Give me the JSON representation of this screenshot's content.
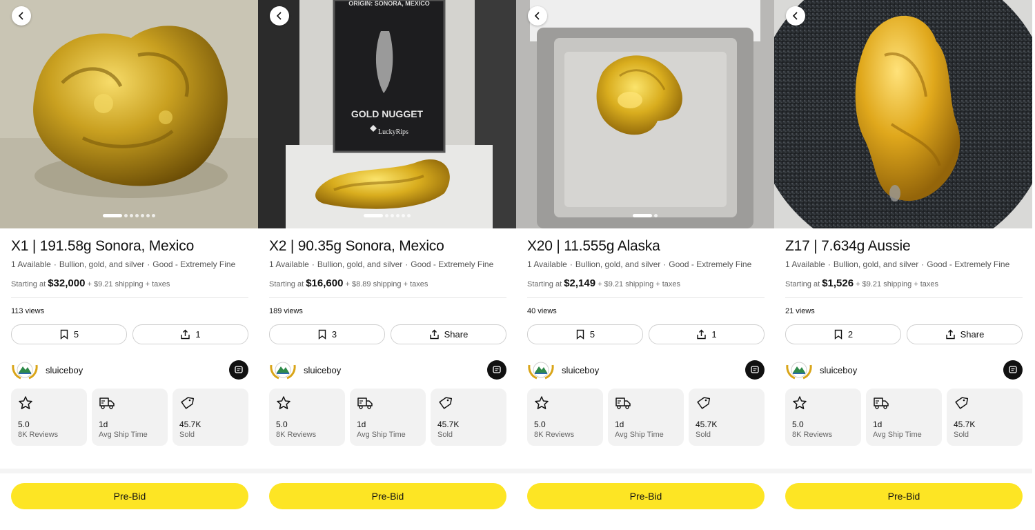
{
  "colors": {
    "accent_yellow": "#fde524",
    "pill_border": "#cfcfcf",
    "stat_bg": "#f2f2f2"
  },
  "panels": [
    {
      "title": "X1 | 191.58g Sonora, Mexico",
      "availability": "1 Available",
      "category": "Bullion, gold, and silver",
      "condition": "Good - Extremely Fine",
      "starting_label": "Starting at",
      "price": "$32,000",
      "shipping": "+ $9.21 shipping + taxes",
      "views": "113 views",
      "save_count": "5",
      "share_label": "1",
      "seller": "sluiceboy",
      "rating": "5.0",
      "rating_label": "8K Reviews",
      "ship_time": "1d",
      "ship_label": "Avg Ship Time",
      "sold": "45.7K",
      "sold_label": "Sold",
      "bid_label": "Pre-Bid",
      "photo_count": 7,
      "photo_index": 1
    },
    {
      "title": "X2 | 90.35g Sonora, Mexico",
      "availability": "1 Available",
      "category": "Bullion, gold, and silver",
      "condition": "Good - Extremely Fine",
      "starting_label": "Starting at",
      "price": "$16,600",
      "shipping": "+ $8.89 shipping + taxes",
      "views": "189 views",
      "save_count": "3",
      "share_label": "Share",
      "seller": "sluiceboy",
      "rating": "5.0",
      "rating_label": "8K Reviews",
      "ship_time": "1d",
      "ship_label": "Avg Ship Time",
      "sold": "45.7K",
      "sold_label": "Sold",
      "bid_label": "Pre-Bid",
      "photo_count": 6,
      "photo_index": 1,
      "card_origin": "ORIGIN: SONORA, MEXICO",
      "card_title": "GOLD NUGGET",
      "card_brand": "LuckyRips"
    },
    {
      "title": "X20 | 11.555g Alaska",
      "availability": "1 Available",
      "category": "Bullion, gold, and silver",
      "condition": "Good - Extremely Fine",
      "starting_label": "Starting at",
      "price": "$2,149",
      "shipping": "+ $9.21 shipping + taxes",
      "views": "40 views",
      "save_count": "5",
      "share_label": "1",
      "seller": "sluiceboy",
      "rating": "5.0",
      "rating_label": "8K Reviews",
      "ship_time": "1d",
      "ship_label": "Avg Ship Time",
      "sold": "45.7K",
      "sold_label": "Sold",
      "bid_label": "Pre-Bid",
      "photo_count": 2,
      "photo_index": 1
    },
    {
      "title": "Z17 | 7.634g Aussie",
      "availability": "1 Available",
      "category": "Bullion, gold, and silver",
      "condition": "Good - Extremely Fine",
      "starting_label": "Starting at",
      "price": "$1,526",
      "shipping": "+ $9.21 shipping + taxes",
      "views": "21 views",
      "save_count": "2",
      "share_label": "Share",
      "seller": "sluiceboy",
      "rating": "5.0",
      "rating_label": "8K Reviews",
      "ship_time": "1d",
      "ship_label": "Avg Ship Time",
      "sold": "45.7K",
      "sold_label": "Sold",
      "bid_label": "Pre-Bid",
      "photo_count": 1,
      "photo_index": 1
    }
  ]
}
